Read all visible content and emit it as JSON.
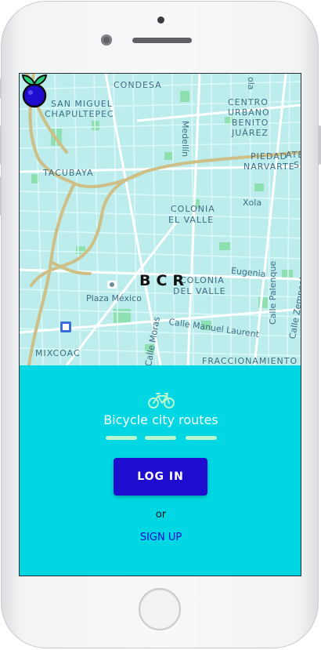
{
  "map": {
    "labels": {
      "condesa": "CONDESA",
      "san_miguel_1": "SAN MIGUEL",
      "san_miguel_2": "CHAPULTEPEC",
      "centro_1": "CENTRO",
      "centro_2": "URBANO",
      "centro_3": "BENITO",
      "centro_4": "JUÁREZ",
      "medellin": "Medellín",
      "ola": "ola",
      "tacubaya": "TACUBAYA",
      "piedad_1": "PIEDAD",
      "piedad_2": "NARVARTE",
      "ate_1": "ATE",
      "ate_2": "S",
      "colonia_valle_1a": "COLONIA",
      "colonia_valle_1b": "EL VALLE",
      "xola": "Xola",
      "eugenia": "Eugenia",
      "colonia_valle_2a": "COLONIA",
      "colonia_valle_2b": "DEL VALLE",
      "plaza_mexico": "Plaza México",
      "calle_palenque": "Calle Palenque",
      "calle_zempoala": "Calle Zempoala",
      "calle_moras": "Calle Moras",
      "calle_laurent": "Calle Manuel Laurent",
      "mixcoac": "MIXCOAC",
      "fraccionamiento": "FRACCIONAMIENTO"
    }
  },
  "brand": {
    "name": "BCR",
    "tagline": "Bicycle city routes"
  },
  "actions": {
    "login_label": "LOG IN",
    "or_label": "or",
    "signup_label": "SIGN UP"
  },
  "colors": {
    "accent": "#00d7e2",
    "primary": "#1e0ccf",
    "highlight": "#b9f7cf"
  },
  "icons": {
    "logo": "blueberry-logo-icon",
    "bike": "bicycle-icon"
  },
  "progress": {
    "steps": 3
  }
}
